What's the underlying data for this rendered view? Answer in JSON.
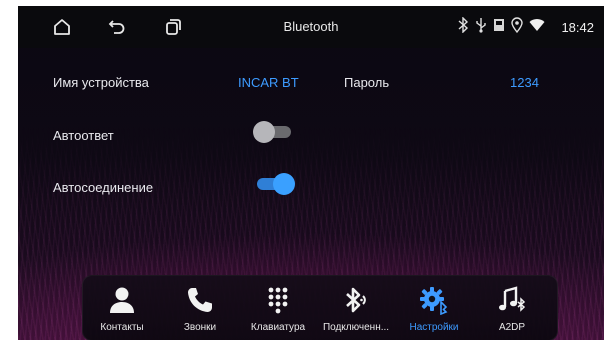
{
  "statusbar": {
    "title": "Bluetooth",
    "time": "18:42",
    "icons": [
      "home-icon",
      "back-icon",
      "recent-apps-icon",
      "bluetooth-icon",
      "usb-icon",
      "sd-card-icon",
      "location-icon",
      "wifi-icon"
    ]
  },
  "settings": {
    "device_name_label": "Имя устройства",
    "device_name_value": "INCAR BT",
    "password_label": "Пароль",
    "password_value": "1234",
    "autoanswer_label": "Автоответ",
    "autoanswer_on": false,
    "autoconnect_label": "Автосоединение",
    "autoconnect_on": true
  },
  "dock": {
    "items": [
      {
        "label": "Контакты",
        "icon": "person-icon",
        "active": false
      },
      {
        "label": "Звонки",
        "icon": "phone-icon",
        "active": false
      },
      {
        "label": "Клавиатура",
        "icon": "dialpad-icon",
        "active": false
      },
      {
        "label": "Подключенн...",
        "icon": "bluetooth-connect-icon",
        "active": false
      },
      {
        "label": "Настройки",
        "icon": "settings-gear-icon",
        "active": true
      },
      {
        "label": "A2DP",
        "icon": "music-note-icon",
        "active": false
      }
    ]
  },
  "colors": {
    "accent": "#3d9bff",
    "toggle_on": "#3aa0ff",
    "toggle_off": "#b6b6ba",
    "text": "#e9e9ee"
  }
}
